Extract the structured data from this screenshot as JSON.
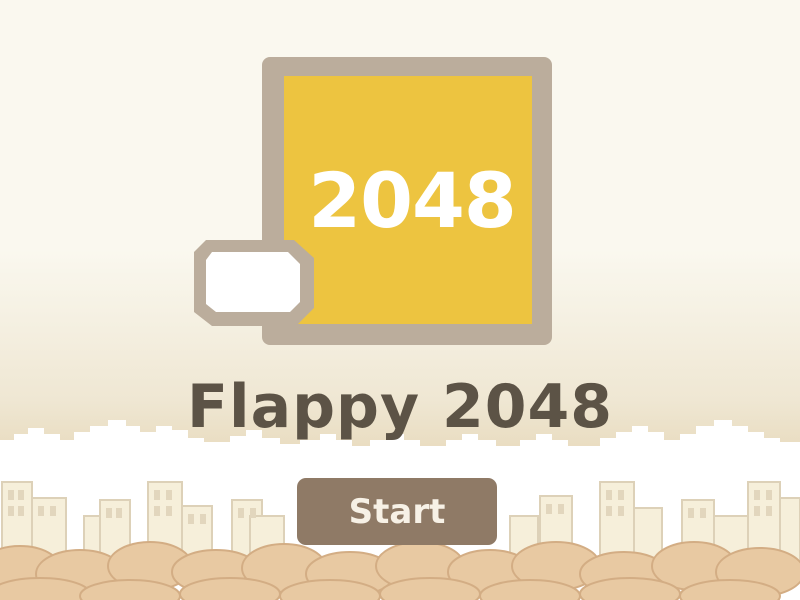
{
  "logo": {
    "tile_value": "2048",
    "tile_color": "#edc440",
    "frame_color": "#bbad9c",
    "bird_icon": "white-tile-bird-icon"
  },
  "title": "Flappy 2048",
  "start_button": {
    "label": "Start",
    "color": "#8f7a66"
  },
  "colors": {
    "background": "#faf8ef",
    "title_text": "#5c5346",
    "clouds": "#ffffff",
    "buildings": "#f7f0d9",
    "bushes": "#e8c9a2"
  }
}
